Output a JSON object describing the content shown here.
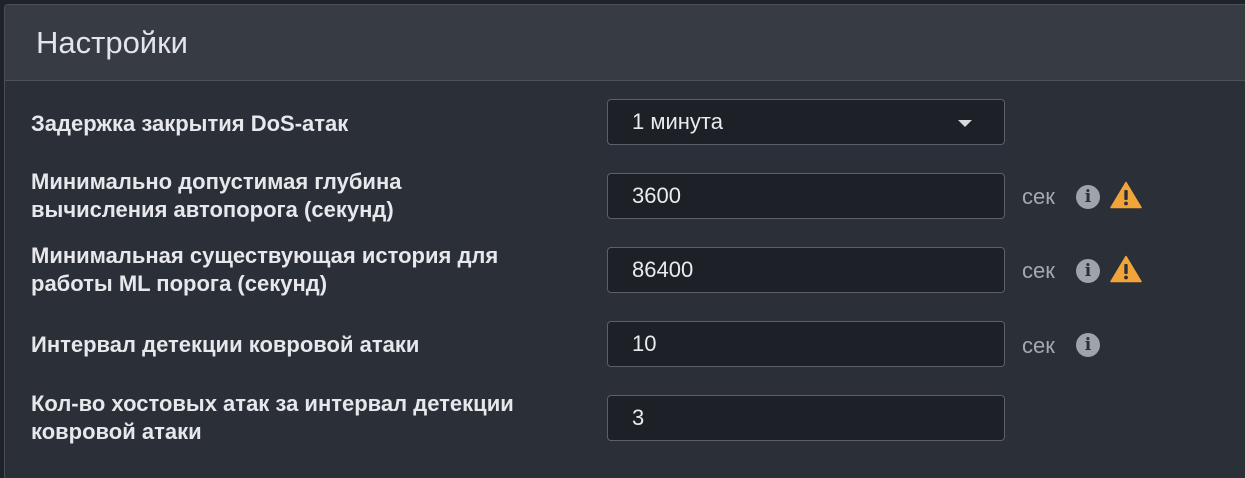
{
  "panel": {
    "title": "Настройки"
  },
  "settings": {
    "dos_delay": {
      "label": "Задержка закрытия DoS-атак",
      "value": "1 минута"
    },
    "auto_threshold_depth": {
      "label_line1": "Минимально допустимая глубина",
      "label_line2": "вычисления автопорога (секунд)",
      "value": "3600",
      "unit": "сек",
      "info_icon": "info-icon",
      "warning_icon": "warning-icon"
    },
    "ml_history": {
      "label_line1": "Минимальная существующая история для",
      "label_line2": "работы ML порога (секунд)",
      "value": "86400",
      "unit": "сек",
      "info_icon": "info-icon",
      "warning_icon": "warning-icon"
    },
    "carpet_interval": {
      "label": "Интервал детекции ковровой атаки",
      "value": "10",
      "unit": "сек",
      "info_icon": "info-icon"
    },
    "host_attacks_count": {
      "label_line1": "Кол-во хостовых атак за интервал детекции",
      "label_line2": "ковровой атаки",
      "value": "3"
    }
  },
  "colors": {
    "warning": "#f0a43a",
    "info": "#9fa3aa"
  }
}
